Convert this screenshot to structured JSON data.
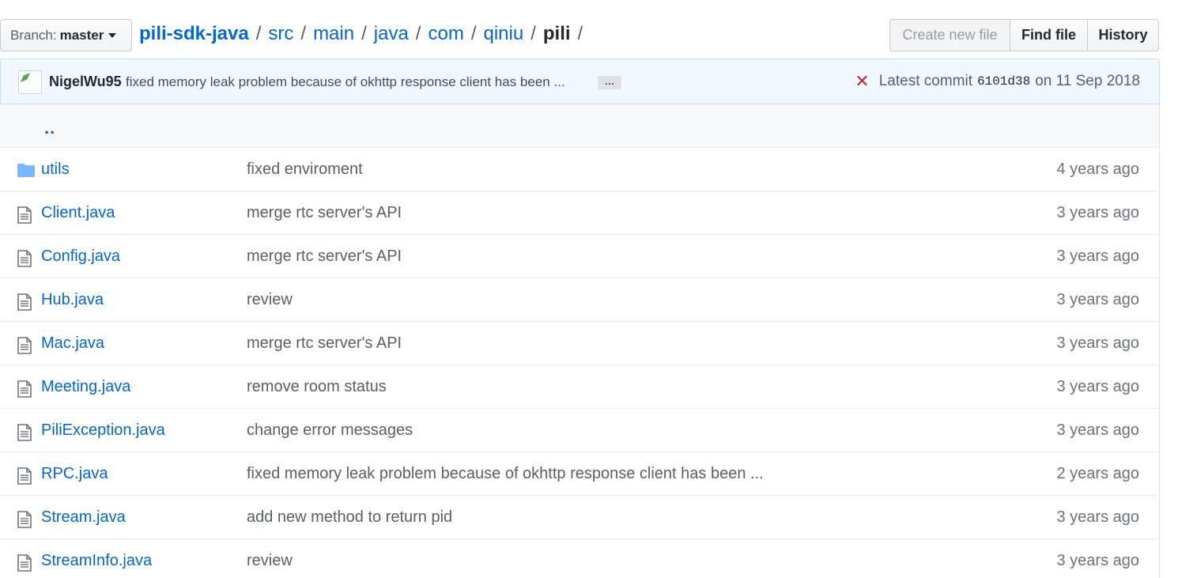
{
  "branch": {
    "label": "Branch:",
    "name": "master"
  },
  "breadcrumb": {
    "root": "pili-sdk-java",
    "parts": [
      "src",
      "main",
      "java",
      "com",
      "qiniu"
    ],
    "current": "pili",
    "separator": "/"
  },
  "buttons": {
    "create_new_file": "Create new file",
    "find_file": "Find file",
    "history": "History"
  },
  "commit": {
    "author": "NigelWu95",
    "message": "fixed memory leak problem because of okhttp response client has been ...",
    "ellipsis": "…",
    "status_icon": "x-icon",
    "status_color": "#cb2431",
    "latest_label": "Latest commit",
    "sha": "6101d38",
    "date_text": "on 11 Sep 2018"
  },
  "parent_dir": "..",
  "files": [
    {
      "type": "dir",
      "name": "utils",
      "message": "fixed enviroment",
      "age": "4 years ago"
    },
    {
      "type": "file",
      "name": "Client.java",
      "message": "merge rtc server's API",
      "age": "3 years ago"
    },
    {
      "type": "file",
      "name": "Config.java",
      "message": "merge rtc server's API",
      "age": "3 years ago"
    },
    {
      "type": "file",
      "name": "Hub.java",
      "message": "review",
      "age": "3 years ago"
    },
    {
      "type": "file",
      "name": "Mac.java",
      "message": "merge rtc server's API",
      "age": "3 years ago"
    },
    {
      "type": "file",
      "name": "Meeting.java",
      "message": "remove room status",
      "age": "3 years ago"
    },
    {
      "type": "file",
      "name": "PiliException.java",
      "message": "change error messages",
      "age": "3 years ago"
    },
    {
      "type": "file",
      "name": "RPC.java",
      "message": "fixed memory leak problem because of okhttp response client has been ...",
      "age": "2 years ago"
    },
    {
      "type": "file",
      "name": "Stream.java",
      "message": "add new method to return pid",
      "age": "3 years ago"
    },
    {
      "type": "file",
      "name": "StreamInfo.java",
      "message": "review",
      "age": "3 years ago"
    }
  ],
  "colors": {
    "link": "#0366d6",
    "commit_bg": "#f1f8ff",
    "folder": "#79b8ff"
  }
}
